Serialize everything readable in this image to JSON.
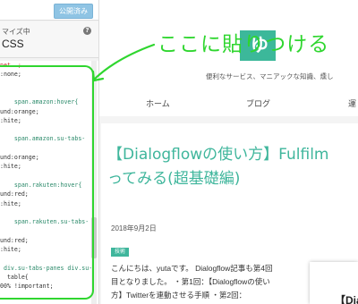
{
  "customizer": {
    "publish_label": "公開済み",
    "section_subtitle": "マイズ中",
    "section_title": "CSS",
    "code_lines": [
      {
        "text": "net  ;",
        "color": "#c03030"
      },
      {
        "text": ":none;",
        "color": "#333333"
      },
      {
        "text": "",
        "color": "#333333"
      },
      {
        "text": "",
        "color": "#333333"
      },
      {
        "text": "    span.amazon:hover{",
        "color": "#2b8a6a"
      },
      {
        "text": "und:orange;",
        "color": "#333333"
      },
      {
        "text": ":hite;",
        "color": "#333333"
      },
      {
        "text": "",
        "color": "#333333"
      },
      {
        "text": "    span.amazon.su-tabs-",
        "color": "#2b8a6a"
      },
      {
        "text": "",
        "color": "#333333"
      },
      {
        "text": "und:orange;",
        "color": "#333333"
      },
      {
        "text": ":hite;",
        "color": "#333333"
      },
      {
        "text": "",
        "color": "#333333"
      },
      {
        "text": "    span.rakuten:hover{",
        "color": "#2b8a6a"
      },
      {
        "text": "und:red;",
        "color": "#333333"
      },
      {
        "text": ":hite;",
        "color": "#333333"
      },
      {
        "text": "",
        "color": "#333333"
      },
      {
        "text": "    span.rakuten.su-tabs-",
        "color": "#2b8a6a"
      },
      {
        "text": "",
        "color": "#333333"
      },
      {
        "text": "und:red;",
        "color": "#333333"
      },
      {
        "text": ":hite;",
        "color": "#333333"
      },
      {
        "text": "",
        "color": "#333333"
      },
      {
        "text": " div.su-tabs-panes div.su-",
        "color": "#2b8a6a"
      },
      {
        "text": "  table{",
        "color": "#333333"
      },
      {
        "text": "00% !important;",
        "color": "#333333"
      },
      {
        "text": "",
        "color": "#333333"
      }
    ]
  },
  "annotation": {
    "text": "ここに貼りつける",
    "color": "#2fd62f"
  },
  "site": {
    "logo_char": "ゆ",
    "tagline": "便利なサービス、マニアックな知識、燻し",
    "nav": [
      "ホーム",
      "ブログ",
      "運"
    ]
  },
  "article": {
    "title_lines": [
      "【Dialogflowの使い方】Fulfilm",
      "ってみる(超基礎編)"
    ],
    "date": "2018年9月2日",
    "tag": "技術",
    "body_lines": [
      "こんにちは、yutaです。 Dialogflow記事も第4回",
      "目となりました。 ・第1回：【Dialogflowの使い",
      "方】Twitterを連動させる手順 ・第2回："
    ],
    "thumb_text": "【Dia"
  }
}
